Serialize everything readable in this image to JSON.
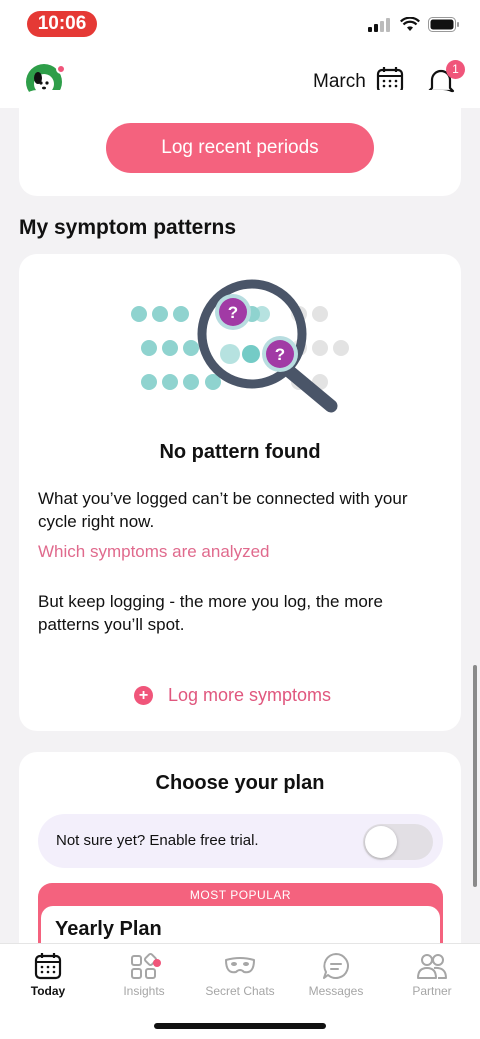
{
  "status_bar": {
    "time": "10:06"
  },
  "header": {
    "month": "March",
    "notification_count": "1"
  },
  "top_card": {
    "log_periods_label": "Log recent periods"
  },
  "patterns": {
    "section_title": "My symptom patterns",
    "headline": "No pattern found",
    "description": "What you’ve logged can’t be connected with your cycle right now.",
    "link": "Which symptoms are analyzed",
    "encourage": "But keep logging - the more you log, the more patterns you’ll spot.",
    "log_more_label": "Log more symptoms"
  },
  "plan": {
    "title": "Choose your plan",
    "trial_label": "Not sure yet? Enable free trial.",
    "trial_enabled": false,
    "badge": "MOST POPULAR",
    "plan_name": "Yearly Plan"
  },
  "tabs": [
    {
      "label": "Today",
      "icon": "calendar-icon",
      "active": true
    },
    {
      "label": "Insights",
      "icon": "insights-icon",
      "active": false
    },
    {
      "label": "Secret Chats",
      "icon": "mask-icon",
      "active": false
    },
    {
      "label": "Messages",
      "icon": "chat-bubble-icon",
      "active": false
    },
    {
      "label": "Partner",
      "icon": "partner-icon",
      "active": false
    }
  ],
  "colors": {
    "accent": "#f4627e",
    "link": "#e06a8d",
    "teal": "#8fd3cf",
    "logo_green": "#2e9e49"
  }
}
